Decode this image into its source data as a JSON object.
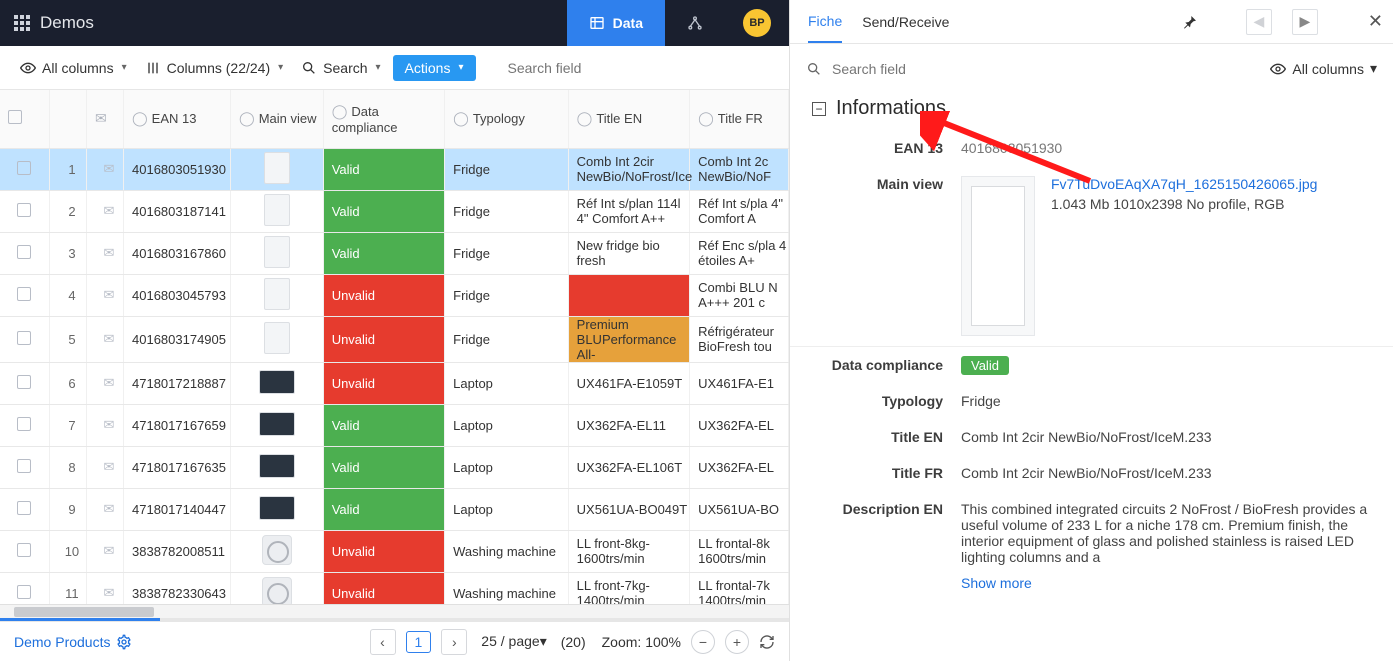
{
  "app": {
    "title": "Demos",
    "avatar_initials": "BP"
  },
  "nav": {
    "data": "Data"
  },
  "toolbar": {
    "all_columns": "All columns",
    "columns_count": "Columns (22/24)",
    "search": "Search",
    "actions": "Actions",
    "search_placeholder": "Search field"
  },
  "columns": {
    "ean": "EAN 13",
    "main_view": "Main view",
    "compliance": "Data compliance",
    "typology": "Typology",
    "title_en": "Title EN",
    "title_fr": "Title FR"
  },
  "rows": [
    {
      "idx": "1",
      "ean": "4016803051930",
      "compliance": "Valid",
      "comp_cls": "valid",
      "typ": "Fridge",
      "en": "Comb Int 2cir NewBio/NoFrost/Ice",
      "en_cls": "",
      "fr": "Comb Int 2c NewBio/NoF",
      "thumb": "fridge",
      "selected": true
    },
    {
      "idx": "2",
      "ean": "4016803187141",
      "compliance": "Valid",
      "comp_cls": "valid",
      "typ": "Fridge",
      "en": "Réf Int s/plan 114l 4\" Comfort A++",
      "en_cls": "",
      "fr": "Réf Int s/pla 4\" Comfort A",
      "thumb": "fridge"
    },
    {
      "idx": "3",
      "ean": "4016803167860",
      "compliance": "Valid",
      "comp_cls": "valid",
      "typ": "Fridge",
      "en": "New fridge bio fresh",
      "en_cls": "",
      "fr": "Réf Enc s/pla 4 étoiles A+",
      "thumb": "fridge"
    },
    {
      "idx": "4",
      "ean": "4016803045793",
      "compliance": "Unvalid",
      "comp_cls": "unvalid",
      "typ": "Fridge",
      "en": "",
      "en_cls": "red-bg",
      "fr": "Combi BLU N A+++ 201 c",
      "thumb": "fridge"
    },
    {
      "idx": "5",
      "ean": "4016803174905",
      "compliance": "Unvalid",
      "comp_cls": "unvalid",
      "typ": "Fridge",
      "en": "Premium BLUPerformance All-",
      "en_cls": "orange-bg",
      "fr": "Réfrigérateur BioFresh tou",
      "thumb": "fridge"
    },
    {
      "idx": "6",
      "ean": "4718017218887",
      "compliance": "Unvalid",
      "comp_cls": "unvalid",
      "typ": "Laptop",
      "en": "UX461FA-E1059T",
      "en_cls": "",
      "fr": "UX461FA-E1",
      "thumb": "laptop"
    },
    {
      "idx": "7",
      "ean": "4718017167659",
      "compliance": "Valid",
      "comp_cls": "valid",
      "typ": "Laptop",
      "en": "UX362FA-EL11",
      "en_cls": "",
      "fr": "UX362FA-EL",
      "thumb": "laptop"
    },
    {
      "idx": "8",
      "ean": "4718017167635",
      "compliance": "Valid",
      "comp_cls": "valid",
      "typ": "Laptop",
      "en": "UX362FA-EL106T",
      "en_cls": "",
      "fr": "UX362FA-EL",
      "thumb": "laptop"
    },
    {
      "idx": "9",
      "ean": "4718017140447",
      "compliance": "Valid",
      "comp_cls": "valid",
      "typ": "Laptop",
      "en": "UX561UA-BO049T",
      "en_cls": "",
      "fr": "UX561UA-BO",
      "thumb": "laptop"
    },
    {
      "idx": "10",
      "ean": "3838782008511",
      "compliance": "Unvalid",
      "comp_cls": "unvalid",
      "typ": "Washing machine",
      "en": "LL front-8kg-1600trs/min",
      "en_cls": "",
      "fr": "LL frontal-8k 1600trs/min",
      "thumb": "wash"
    },
    {
      "idx": "11",
      "ean": "3838782330643",
      "compliance": "Unvalid",
      "comp_cls": "unvalid",
      "typ": "Washing machine",
      "en": "LL front-7kg-1400trs/min",
      "en_cls": "",
      "fr": "LL frontal-7k 1400trs/min",
      "thumb": "wash"
    }
  ],
  "footer": {
    "product_set": "Demo Products",
    "page_current": "1",
    "per_page": "25 / page",
    "total": "(20)",
    "zoom": "Zoom: 100%"
  },
  "detail": {
    "tabs": {
      "fiche": "Fiche",
      "send": "Send/Receive"
    },
    "search_placeholder": "Search field",
    "all_columns": "All columns",
    "section_title": "Informations",
    "ean_label": "EAN 13",
    "ean_val": "4016803051930",
    "mainview_label": "Main view",
    "file_name": "Fv7TuDvoEAqXA7qH_1625150426065.jpg",
    "file_meta": "1.043 Mb 1010x2398 No profile, RGB",
    "comp_label": "Data compliance",
    "comp_val": "Valid",
    "typ_label": "Typology",
    "typ_val": "Fridge",
    "title_en_label": "Title EN",
    "title_en_val": "Comb Int 2cir NewBio/NoFrost/IceM.233",
    "title_fr_label": "Title FR",
    "title_fr_val": "Comb Int 2cir NewBio/NoFrost/IceM.233",
    "desc_en_label": "Description EN",
    "desc_en_val": "This combined integrated circuits 2 NoFrost / BioFresh provides a useful volume of 233 L for a niche 178 cm. Premium finish, the interior equipment of glass and polished stainless is raised LED lighting columns and a",
    "show_more": "Show more"
  }
}
